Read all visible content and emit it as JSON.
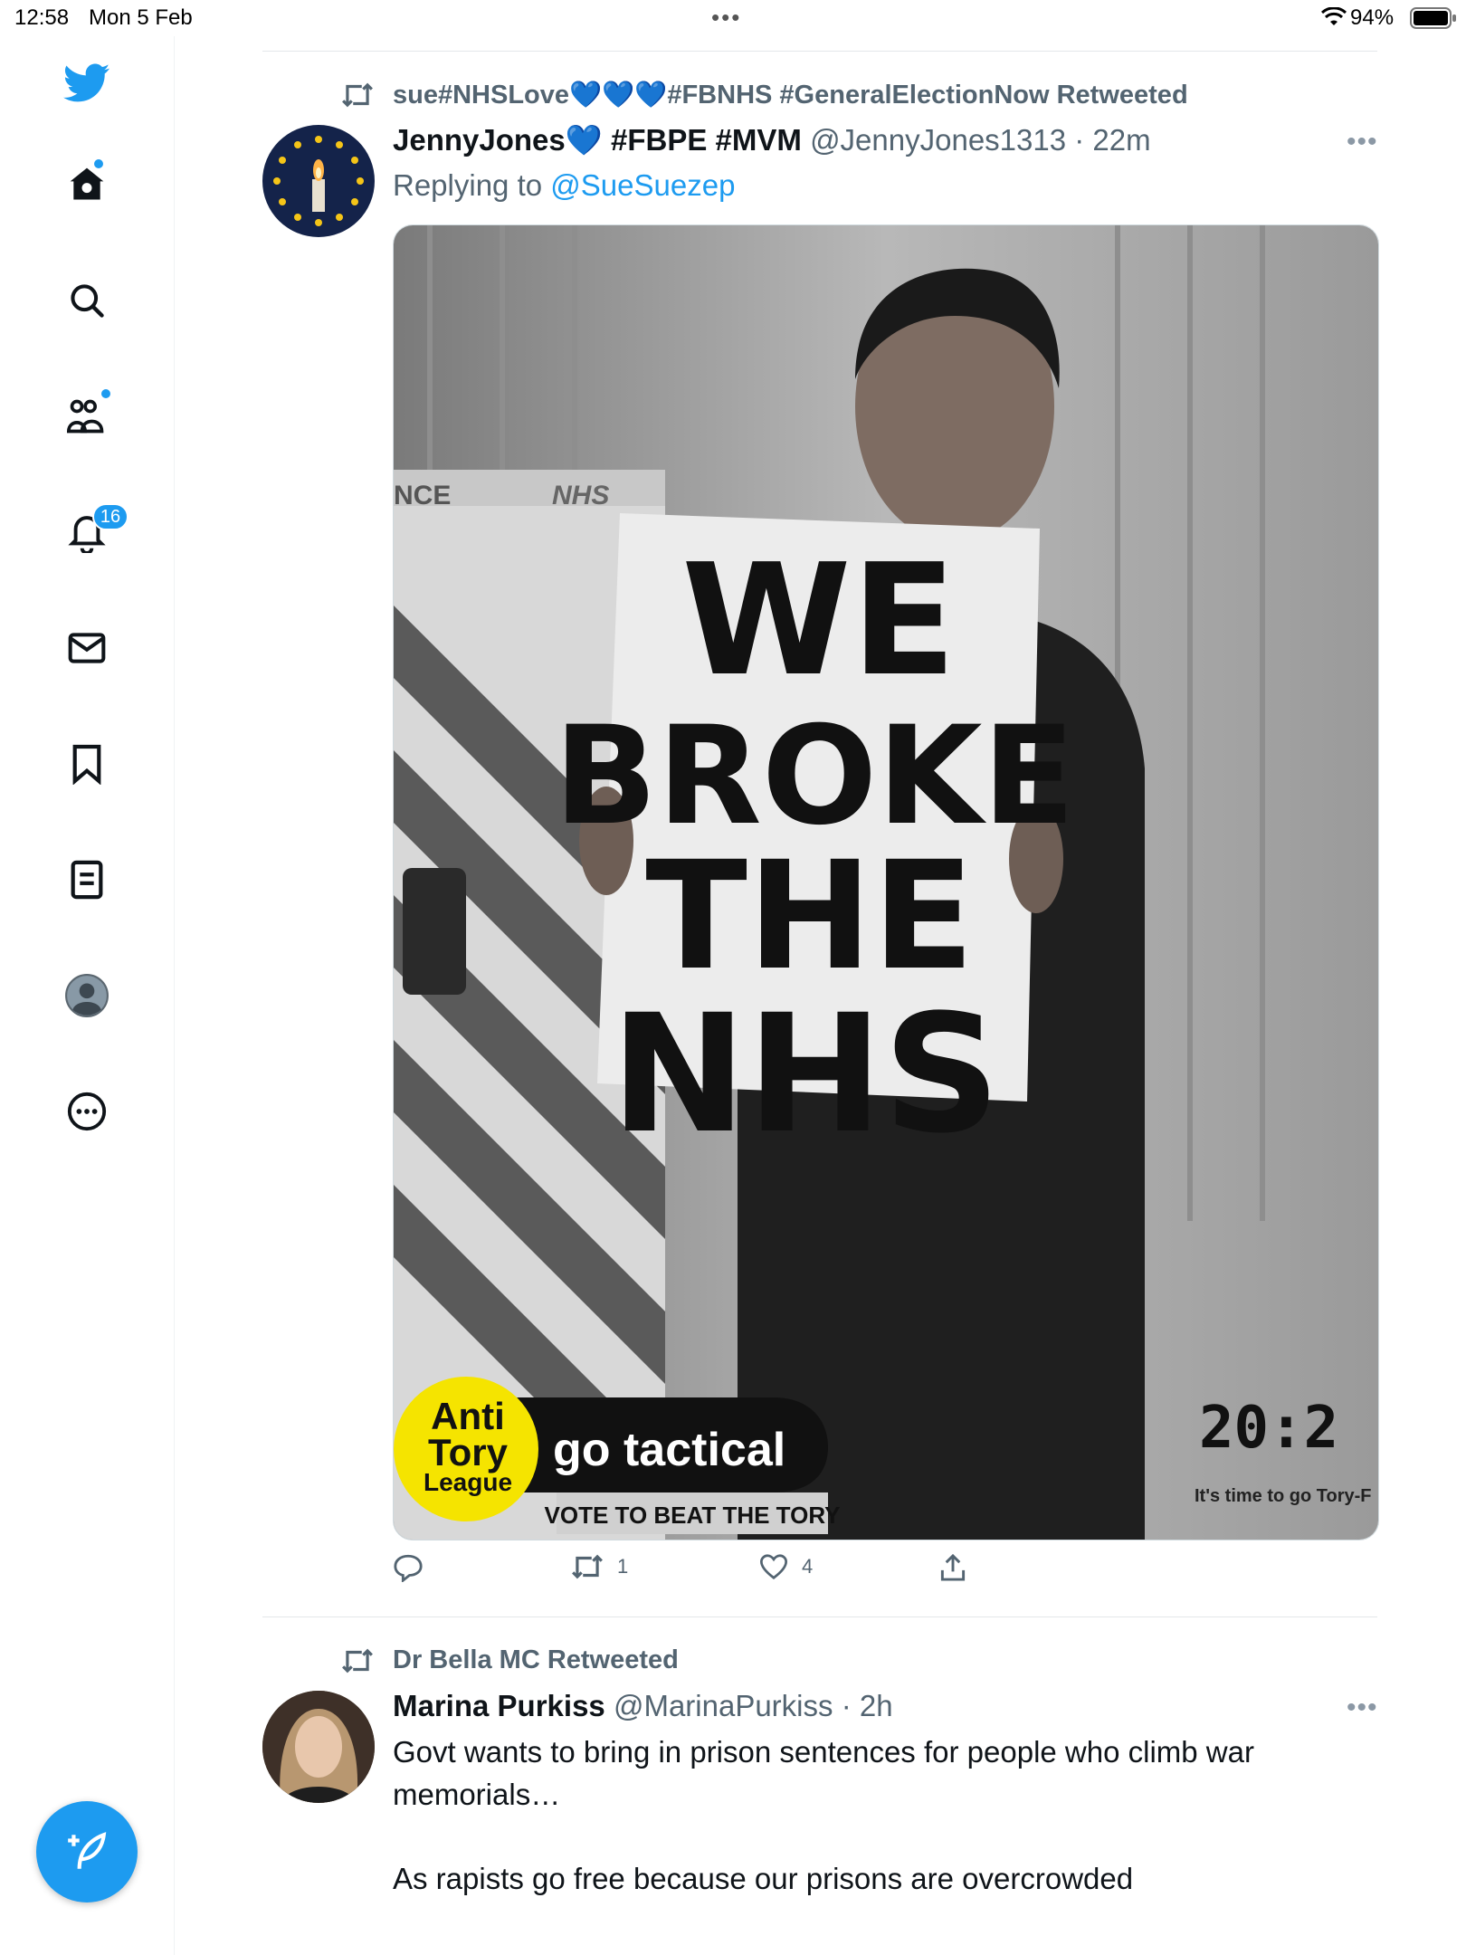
{
  "status_bar": {
    "time": "12:58",
    "date": "Mon 5 Feb",
    "battery": "94%"
  },
  "sidebar": {
    "items": [
      {
        "name": "home"
      },
      {
        "name": "explore"
      },
      {
        "name": "communities"
      },
      {
        "name": "notifications",
        "badge": "16"
      },
      {
        "name": "messages"
      },
      {
        "name": "bookmarks"
      },
      {
        "name": "lists"
      },
      {
        "name": "profile"
      },
      {
        "name": "more"
      }
    ],
    "compose_icon": "compose-feather-icon"
  },
  "tweets": [
    {
      "retweeted_by": "sue#NHSLove💙💙💙#FBNHS #GeneralElectionNow Retweeted",
      "author": "JennyJones💙 #FBPE #MVM",
      "handle": "@JennyJones1313",
      "time": "· 22m",
      "reply_prefix": "Replying to",
      "reply_handle": "@SueSuezep",
      "image": {
        "sign_line1": "WE",
        "sign_line2": "BROKE",
        "sign_line3": "THE",
        "sign_line4": "NHS",
        "ambulance_text1": "NCE",
        "ambulance_text2": "NHS",
        "logo_line1": "Anti",
        "logo_line2": "Tory",
        "logo_line3": "League",
        "banner": "go tactical",
        "banner_sub": "VOTE TO BEAT THE TORY",
        "year": "20:2",
        "tagline": "It's time to go Tory-F"
      },
      "retweets": "1",
      "likes": "4"
    },
    {
      "retweeted_by": "Dr Bella MC Retweeted",
      "author": "Marina Purkiss",
      "handle": "@MarinaPurkiss",
      "time": "· 2h",
      "text_p1": "Govt wants to bring in prison sentences for people who climb war memorials…",
      "text_p2": "As rapists go free because our prisons are overcrowded"
    }
  ],
  "colors": {
    "accent": "#1d9bf0",
    "text": "#0f1419",
    "muted": "#536471"
  }
}
